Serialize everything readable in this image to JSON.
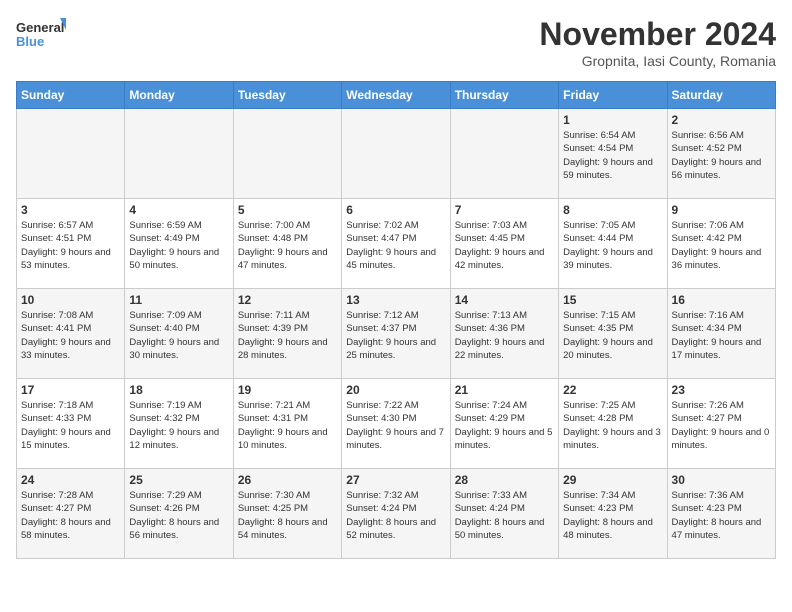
{
  "header": {
    "logo_general": "General",
    "logo_blue": "Blue",
    "title": "November 2024",
    "subtitle": "Gropnita, Iasi County, Romania"
  },
  "days_of_week": [
    "Sunday",
    "Monday",
    "Tuesday",
    "Wednesday",
    "Thursday",
    "Friday",
    "Saturday"
  ],
  "weeks": [
    [
      {
        "day": "",
        "info": ""
      },
      {
        "day": "",
        "info": ""
      },
      {
        "day": "",
        "info": ""
      },
      {
        "day": "",
        "info": ""
      },
      {
        "day": "",
        "info": ""
      },
      {
        "day": "1",
        "info": "Sunrise: 6:54 AM\nSunset: 4:54 PM\nDaylight: 9 hours and 59 minutes."
      },
      {
        "day": "2",
        "info": "Sunrise: 6:56 AM\nSunset: 4:52 PM\nDaylight: 9 hours and 56 minutes."
      }
    ],
    [
      {
        "day": "3",
        "info": "Sunrise: 6:57 AM\nSunset: 4:51 PM\nDaylight: 9 hours and 53 minutes."
      },
      {
        "day": "4",
        "info": "Sunrise: 6:59 AM\nSunset: 4:49 PM\nDaylight: 9 hours and 50 minutes."
      },
      {
        "day": "5",
        "info": "Sunrise: 7:00 AM\nSunset: 4:48 PM\nDaylight: 9 hours and 47 minutes."
      },
      {
        "day": "6",
        "info": "Sunrise: 7:02 AM\nSunset: 4:47 PM\nDaylight: 9 hours and 45 minutes."
      },
      {
        "day": "7",
        "info": "Sunrise: 7:03 AM\nSunset: 4:45 PM\nDaylight: 9 hours and 42 minutes."
      },
      {
        "day": "8",
        "info": "Sunrise: 7:05 AM\nSunset: 4:44 PM\nDaylight: 9 hours and 39 minutes."
      },
      {
        "day": "9",
        "info": "Sunrise: 7:06 AM\nSunset: 4:42 PM\nDaylight: 9 hours and 36 minutes."
      }
    ],
    [
      {
        "day": "10",
        "info": "Sunrise: 7:08 AM\nSunset: 4:41 PM\nDaylight: 9 hours and 33 minutes."
      },
      {
        "day": "11",
        "info": "Sunrise: 7:09 AM\nSunset: 4:40 PM\nDaylight: 9 hours and 30 minutes."
      },
      {
        "day": "12",
        "info": "Sunrise: 7:11 AM\nSunset: 4:39 PM\nDaylight: 9 hours and 28 minutes."
      },
      {
        "day": "13",
        "info": "Sunrise: 7:12 AM\nSunset: 4:37 PM\nDaylight: 9 hours and 25 minutes."
      },
      {
        "day": "14",
        "info": "Sunrise: 7:13 AM\nSunset: 4:36 PM\nDaylight: 9 hours and 22 minutes."
      },
      {
        "day": "15",
        "info": "Sunrise: 7:15 AM\nSunset: 4:35 PM\nDaylight: 9 hours and 20 minutes."
      },
      {
        "day": "16",
        "info": "Sunrise: 7:16 AM\nSunset: 4:34 PM\nDaylight: 9 hours and 17 minutes."
      }
    ],
    [
      {
        "day": "17",
        "info": "Sunrise: 7:18 AM\nSunset: 4:33 PM\nDaylight: 9 hours and 15 minutes."
      },
      {
        "day": "18",
        "info": "Sunrise: 7:19 AM\nSunset: 4:32 PM\nDaylight: 9 hours and 12 minutes."
      },
      {
        "day": "19",
        "info": "Sunrise: 7:21 AM\nSunset: 4:31 PM\nDaylight: 9 hours and 10 minutes."
      },
      {
        "day": "20",
        "info": "Sunrise: 7:22 AM\nSunset: 4:30 PM\nDaylight: 9 hours and 7 minutes."
      },
      {
        "day": "21",
        "info": "Sunrise: 7:24 AM\nSunset: 4:29 PM\nDaylight: 9 hours and 5 minutes."
      },
      {
        "day": "22",
        "info": "Sunrise: 7:25 AM\nSunset: 4:28 PM\nDaylight: 9 hours and 3 minutes."
      },
      {
        "day": "23",
        "info": "Sunrise: 7:26 AM\nSunset: 4:27 PM\nDaylight: 9 hours and 0 minutes."
      }
    ],
    [
      {
        "day": "24",
        "info": "Sunrise: 7:28 AM\nSunset: 4:27 PM\nDaylight: 8 hours and 58 minutes."
      },
      {
        "day": "25",
        "info": "Sunrise: 7:29 AM\nSunset: 4:26 PM\nDaylight: 8 hours and 56 minutes."
      },
      {
        "day": "26",
        "info": "Sunrise: 7:30 AM\nSunset: 4:25 PM\nDaylight: 8 hours and 54 minutes."
      },
      {
        "day": "27",
        "info": "Sunrise: 7:32 AM\nSunset: 4:24 PM\nDaylight: 8 hours and 52 minutes."
      },
      {
        "day": "28",
        "info": "Sunrise: 7:33 AM\nSunset: 4:24 PM\nDaylight: 8 hours and 50 minutes."
      },
      {
        "day": "29",
        "info": "Sunrise: 7:34 AM\nSunset: 4:23 PM\nDaylight: 8 hours and 48 minutes."
      },
      {
        "day": "30",
        "info": "Sunrise: 7:36 AM\nSunset: 4:23 PM\nDaylight: 8 hours and 47 minutes."
      }
    ]
  ]
}
